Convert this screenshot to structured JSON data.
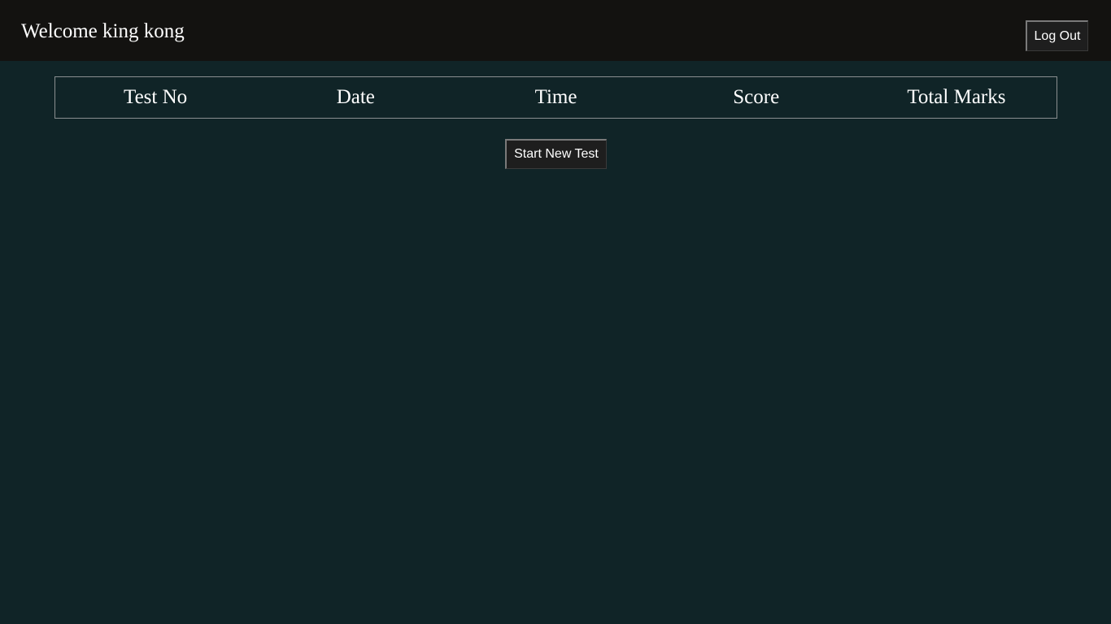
{
  "header": {
    "welcome_text": "Welcome king kong",
    "logout_label": "Log Out"
  },
  "table": {
    "columns": [
      "Test No",
      "Date",
      "Time",
      "Score",
      "Total Marks"
    ],
    "rows": []
  },
  "actions": {
    "start_new_test_label": "Start New Test"
  },
  "colors": {
    "page_background": "#102427",
    "header_background": "#131210",
    "button_background": "#1e1e1e",
    "text": "#ffffff"
  }
}
